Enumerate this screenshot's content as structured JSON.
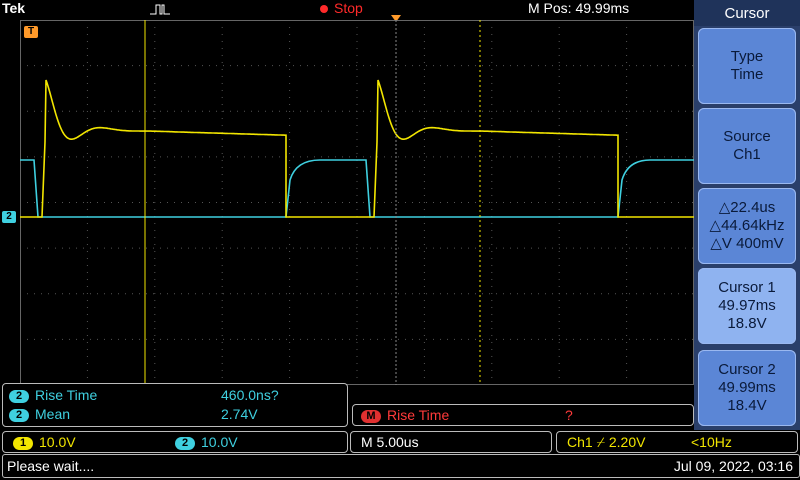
{
  "brand": "Tek",
  "acquisition": {
    "state": "Stop"
  },
  "horizontal": {
    "position": "M Pos: 49.99ms",
    "scale": "M 5.00us"
  },
  "markers": {
    "ch2_level": "2",
    "trigger_marker": "T"
  },
  "menu": {
    "title": "Cursor",
    "items": [
      {
        "line1": "Type",
        "line2": "Time",
        "line3": ""
      },
      {
        "line1": "Source",
        "line2": "Ch1",
        "line3": ""
      },
      {
        "line1": "△22.4us",
        "line2": "△44.64kHz",
        "line3": "△V 400mV"
      },
      {
        "line1": "Cursor 1",
        "line2": "49.97ms",
        "line3": "18.8V"
      },
      {
        "line1": "Cursor 2",
        "line2": "49.99ms",
        "line3": "18.4V"
      }
    ]
  },
  "measurements": [
    {
      "channel": "2",
      "name": "Rise Time",
      "value": "460.0ns?"
    },
    {
      "channel": "2",
      "name": "Mean",
      "value": "2.74V"
    }
  ],
  "math_measurement": {
    "channel": "M",
    "name": "Rise Time",
    "value": "?"
  },
  "channels": [
    {
      "channel": "1",
      "scale": "10.0V"
    },
    {
      "channel": "2",
      "scale": "10.0V"
    }
  ],
  "trigger": {
    "source": "Ch1",
    "slope": "⌿",
    "level": "2.20V",
    "freq": "<10Hz"
  },
  "status": {
    "message": "Please wait....",
    "datetime": "Jul 09, 2022, 03:16"
  },
  "colors": {
    "ch1": "#f2e600",
    "ch2": "#3fd0e0",
    "menu_bg": "#2a3f6a",
    "menu_button": "#5b86d6",
    "stop": "#ff2a2a"
  }
}
